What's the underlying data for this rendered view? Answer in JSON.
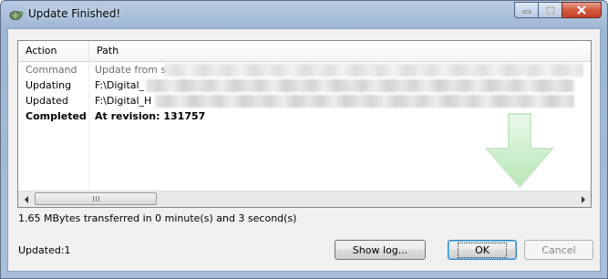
{
  "window": {
    "title": "Update Finished!",
    "icon": "tortoise-icon"
  },
  "caption_buttons": {
    "minimize_icon": "minimize-icon",
    "maximize_icon": "maximize-icon",
    "close_icon": "close-icon"
  },
  "list": {
    "columns": [
      "Action",
      "Path"
    ],
    "rows": [
      {
        "action": "Command",
        "path": "Update from s",
        "style": "muted"
      },
      {
        "action": "Updating",
        "path": "F:\\Digital_",
        "style": "normal"
      },
      {
        "action": "Updated",
        "path": "F:\\Digital_H",
        "style": "normal"
      },
      {
        "action": "Completed",
        "path": "At revision: 131757",
        "style": "bold"
      }
    ]
  },
  "transfer_info": "1.65 MBytes transferred in 0 minute(s) and 3 second(s)",
  "status": "Updated:1",
  "buttons": {
    "show_log": "Show log...",
    "ok": "OK",
    "cancel": "Cancel"
  },
  "colors": {
    "accent_arrow": "#7ed27e",
    "muted_text": "#6d6d6d",
    "ok_focus_border": "#3c7fb1"
  }
}
